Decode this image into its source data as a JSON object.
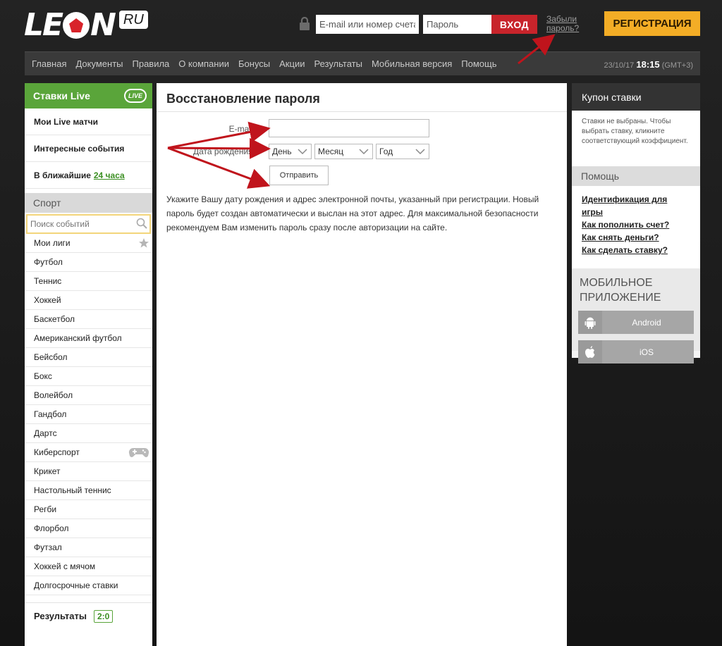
{
  "header": {
    "logo_text_a": "LE",
    "logo_text_b": "N",
    "logo_ru": "RU",
    "login_placeholder": "E-mail или номер счета",
    "password_placeholder": "Пароль",
    "login_button": "ВХОД",
    "forgot_password": "Забыли пароль?",
    "register_button": "РЕГИСТРАЦИЯ"
  },
  "nav": {
    "items": [
      "Главная",
      "Документы",
      "Правила",
      "О компании",
      "Бонусы",
      "Акции",
      "Результаты",
      "Мобильная версия",
      "Помощь"
    ],
    "date": "23/10/17",
    "time": "18:15",
    "tz": "(GMT+3)"
  },
  "left": {
    "live_header": "Ставки Live",
    "live_badge": "LIVE",
    "live_items": {
      "my_matches": "Мои Live матчи",
      "interesting": "Интересные события",
      "nearest_prefix": "В ближайшие",
      "nearest_link": "24 часа"
    },
    "sport_header": "Спорт",
    "search_placeholder": "Поиск событий",
    "sports": [
      "Мои лиги",
      "Футбол",
      "Теннис",
      "Хоккей",
      "Баскетбол",
      "Американский футбол",
      "Бейсбол",
      "Бокс",
      "Волейбол",
      "Гандбол",
      "Дартс",
      "Киберспорт",
      "Крикет",
      "Настольный теннис",
      "Регби",
      "Флорбол",
      "Футзал",
      "Хоккей с мячом",
      "Долгосрочные ставки"
    ],
    "results_label": "Результаты",
    "results_badge": "2:0"
  },
  "main": {
    "title": "Восстановление пароля",
    "email_label": "E-mail:",
    "dob_label": "Дата рождения:",
    "day": "День",
    "month": "Месяц",
    "year": "Год",
    "submit": "Отправить",
    "info": "Укажите Вашу дату рождения и адрес электронной почты, указанный при регистрации. Новый пароль будет создан автоматически и выслан на этот адрес. Для максимальной безопасности рекомендуем Вам изменить пароль сразу после авторизации на сайте."
  },
  "right": {
    "coupon_header": "Купон ставки",
    "coupon_text": "Ставки не выбраны. Чтобы выбрать ставку, кликните соответствующий коэффициент.",
    "help_header": "Помощь",
    "help_links": [
      "Идентификация для игры",
      "Как пополнить счет?",
      "Как снять деньги?",
      "Как сделать ставку?"
    ],
    "mobile_title": "МОБИЛЬНОЕ ПРИЛОЖЕНИЕ",
    "android": "Android",
    "ios": "iOS"
  },
  "colors": {
    "live_green": "#5aa53a",
    "login_red": "#c8242b",
    "register_orange": "#f3ad26",
    "arrow_red": "#c0141c"
  }
}
